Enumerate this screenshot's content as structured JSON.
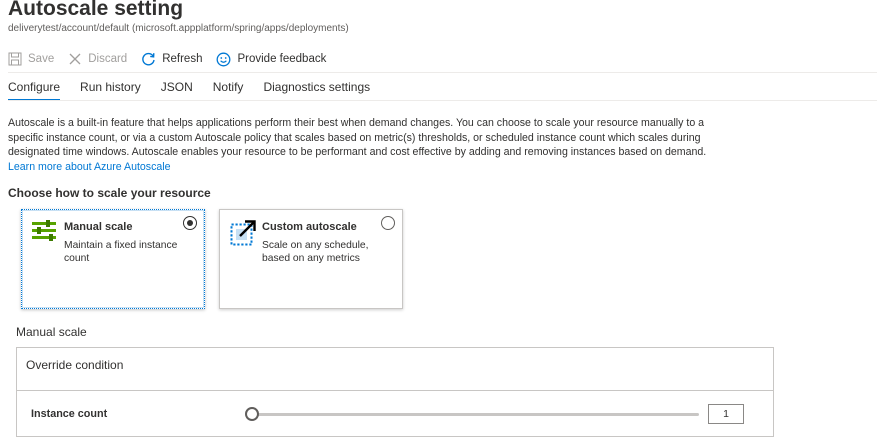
{
  "header": {
    "title": "Autoscale setting",
    "subtitle": "deliverytest/account/default (microsoft.appplatform/spring/apps/deployments)"
  },
  "toolbar": {
    "save_label": "Save",
    "discard_label": "Discard",
    "refresh_label": "Refresh",
    "feedback_label": "Provide feedback",
    "icons": [
      "save-icon",
      "discard-icon",
      "refresh-icon",
      "feedback-icon"
    ]
  },
  "tabs": [
    {
      "label": "Configure",
      "active": true
    },
    {
      "label": "Run history",
      "active": false
    },
    {
      "label": "JSON",
      "active": false
    },
    {
      "label": "Notify",
      "active": false
    },
    {
      "label": "Diagnostics settings",
      "active": false
    }
  ],
  "description": {
    "text": "Autoscale is a built-in feature that helps applications perform their best when demand changes. You can choose to scale your resource manually to a specific instance count, or via a custom Autoscale policy that scales based on metric(s) thresholds, or scheduled instance count which scales during designated time windows. Autoscale enables your resource to be performant and cost effective by adding and removing instances based on demand.",
    "link": "Learn more about Azure Autoscale"
  },
  "choose_heading": "Choose how to scale your resource",
  "options": {
    "manual": {
      "title": "Manual scale",
      "description": "Maintain a fixed instance count",
      "selected": true
    },
    "custom": {
      "title": "Custom autoscale",
      "description": "Scale on any schedule, based on any metrics",
      "selected": false
    }
  },
  "manual_scale": {
    "section_label": "Manual scale",
    "override_label": "Override condition",
    "instance_count_label": "Instance count",
    "instance_count_value": "1",
    "slider_fraction": 0
  },
  "colors": {
    "accent": "#0078d4",
    "text": "#323130",
    "disabled": "#a19f9d",
    "icon_green": "#57a300"
  }
}
